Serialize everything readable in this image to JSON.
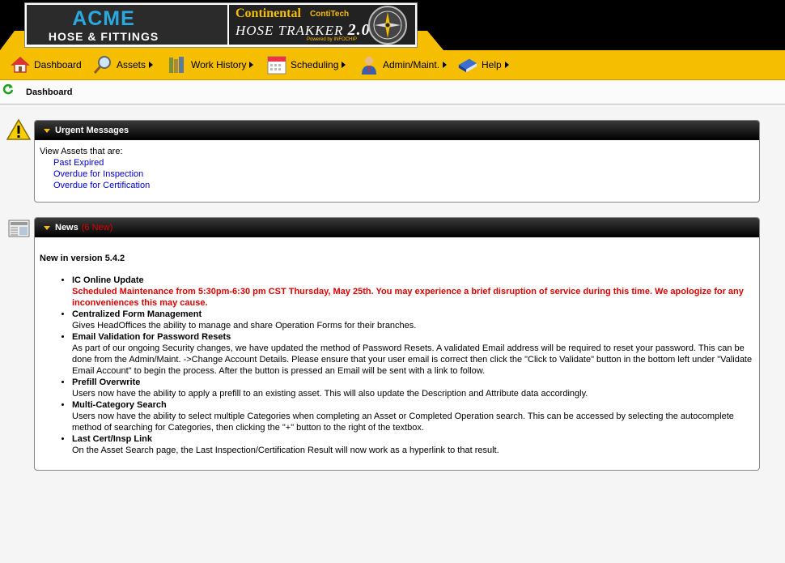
{
  "header": {
    "acme_title": "ACME",
    "acme_sub": "HOSE & FITTINGS",
    "conti_brand": "Continental",
    "conti_sub": "ContiTech",
    "trakker": "HOSE TRAKKER",
    "version": "2.0",
    "powered": "Powered by INFOCHIP",
    "accent": "#f6be00"
  },
  "menu": [
    {
      "label": "Dashboard",
      "icon": "house-icon",
      "has_arrow": false
    },
    {
      "label": "Assets",
      "icon": "magnifier-icon",
      "has_arrow": true
    },
    {
      "label": "Work History",
      "icon": "books-icon",
      "has_arrow": true
    },
    {
      "label": "Scheduling",
      "icon": "calendar-icon",
      "has_arrow": true
    },
    {
      "label": "Admin/Maint.",
      "icon": "user-icon",
      "has_arrow": true
    },
    {
      "label": "Help",
      "icon": "help-book-icon",
      "has_arrow": true
    }
  ],
  "breadcrumb": {
    "title": "Dashboard"
  },
  "urgent": {
    "title": "Urgent Messages",
    "intro": "View Assets that are:",
    "links": [
      "Past Expired",
      "Overdue for Inspection",
      "Overdue for Certification"
    ]
  },
  "news": {
    "title": "News",
    "new_count": "(6 New)",
    "version": "New in version 5.4.2",
    "items": [
      {
        "title": "IC Online Update",
        "text": "",
        "red": "Scheduled Maintenance from 5:30pm-6:30 pm CST Thursday, May 25th. You may experience a brief disruption of service during this time. We apologize for any inconveniences this may cause."
      },
      {
        "title": "Centralized Form Management",
        "text": "Gives HeadOffices the ability to manage and share Operation Forms for their branches.",
        "red": ""
      },
      {
        "title": "Email Validation for Password Resets",
        "text": "As part of our ongoing Security changes, we have updated the method of Password Resets. A validated Email address will be required to reset your password. This can be done from the Admin/Maint. ->Change Account Details. Please ensure that your user email is correct then click the \"Click to Validate\" button in the bottom left under \"Validate Email Account\" to begin the process. After the button is pressed an Email will be sent with a link to follow.",
        "red": ""
      },
      {
        "title": "Prefill Overwrite",
        "text": "Users now have the ability to apply a prefill to an existing asset. This will also update the Description and Attribute data accordingly.",
        "red": ""
      },
      {
        "title": "Multi-Category Search",
        "text": "Users now have the ability to select multiple Categories when completing an Asset or Completed Operation search. This can be accessed by selecting the autocomplete method of searching for Categories, then clicking the \"+\" button to the right of the textbox.",
        "red": ""
      },
      {
        "title": "Last Cert/Insp Link",
        "text": "On the Asset Search page, the Last Inspection/Certification Result will now work as a hyperlink to that result.",
        "red": ""
      }
    ]
  }
}
